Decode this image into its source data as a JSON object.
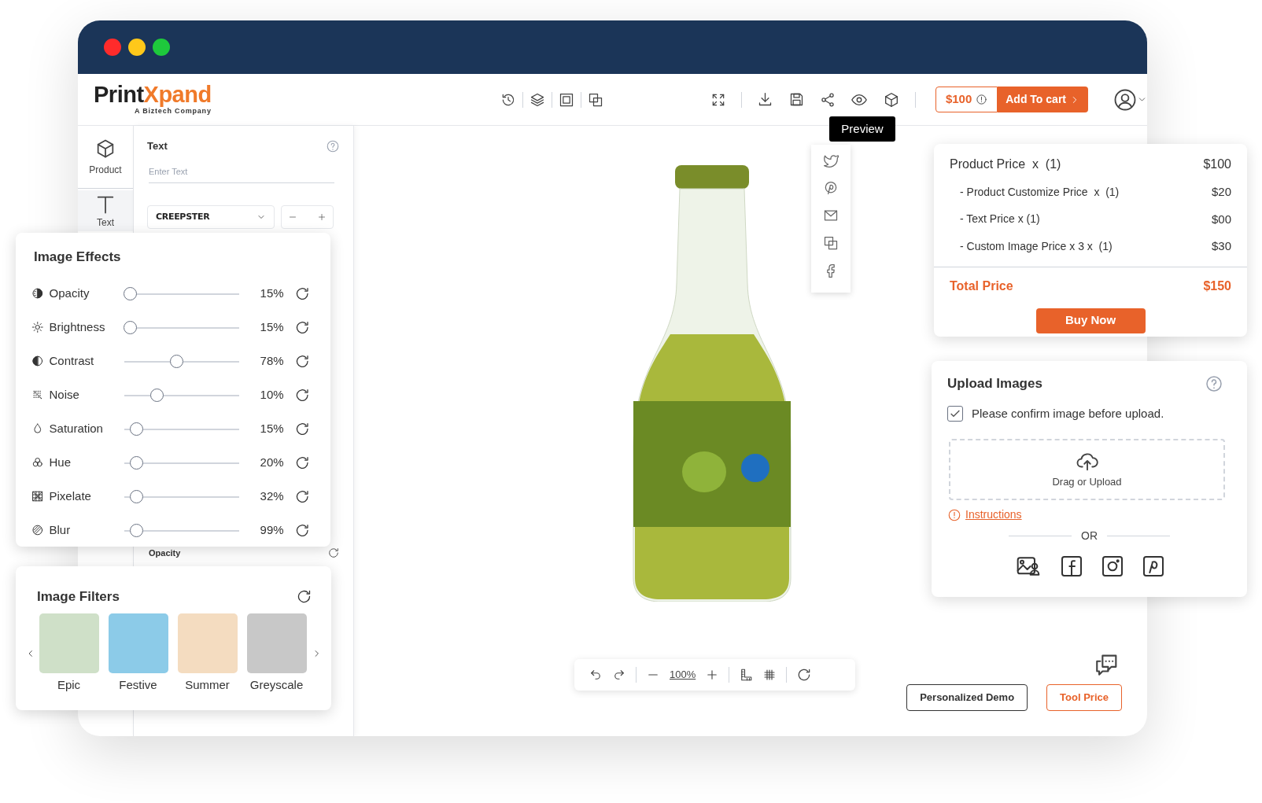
{
  "logo": {
    "brand_dark": "Print",
    "brand_accent": "Xpand",
    "tagline": "A Biztech Company"
  },
  "price_button": {
    "price": "$100",
    "action": "Add To cart"
  },
  "tooltip": "Preview",
  "rail": [
    {
      "label": "Product",
      "selected": false
    },
    {
      "label": "Text",
      "selected": true
    }
  ],
  "text_panel": {
    "title": "Text",
    "placeholder": "Enter Text",
    "font": "CREEPSTER",
    "section_label": "Opacity"
  },
  "image_effects": {
    "title": "Image Effects",
    "rows": [
      {
        "label": "Opacity",
        "level": 0.05,
        "reading": "15%"
      },
      {
        "label": "Brightness",
        "level": 0.05,
        "reading": "15%"
      },
      {
        "label": "Contrast",
        "level": 0.45,
        "reading": "78%"
      },
      {
        "label": "Noise",
        "level": 0.28,
        "reading": "10%"
      },
      {
        "label": "Saturation",
        "level": 0.1,
        "reading": "15%"
      },
      {
        "label": "Hue",
        "level": 0.1,
        "reading": "20%"
      },
      {
        "label": "Pixelate",
        "level": 0.1,
        "reading": "32%"
      },
      {
        "label": "Blur",
        "level": 0.1,
        "reading": "99%"
      }
    ]
  },
  "image_filters": {
    "title": "Image Filters",
    "items": [
      {
        "label": "Epic",
        "color": "#cfe0c8"
      },
      {
        "label": "Festive",
        "color": "#8ccbe8"
      },
      {
        "label": "Summer",
        "color": "#f4dcc0"
      },
      {
        "label": "Greyscale",
        "color": "#c8c8c8"
      }
    ]
  },
  "price_summary": {
    "rows": [
      {
        "kind": "main",
        "label": "Product Price  x  (1)",
        "amount": "$100"
      },
      {
        "kind": "sub",
        "label": "- Product Customize Price  x  (1)",
        "amount": "$20"
      },
      {
        "kind": "sub",
        "label": "- Text Price x (1)",
        "amount": "$00"
      },
      {
        "kind": "sub",
        "label": "- Custom Image Price x 3 x  (1)",
        "amount": "$30"
      }
    ],
    "total_label": "Total Price",
    "total": "$150",
    "button": "Buy Now"
  },
  "upload": {
    "title": "Upload Images",
    "confirm": {
      "label": "Please confirm image before upload.",
      "checked": true
    },
    "drop_label": "Drag or Upload",
    "instructions": "Instructions",
    "or": "OR"
  },
  "zoom_toolbar": {
    "zoom": "100%"
  },
  "buttons": [
    {
      "kind": "outline",
      "label": "Personalized Demo"
    },
    {
      "kind": "accent",
      "label": "Tool Price"
    }
  ]
}
